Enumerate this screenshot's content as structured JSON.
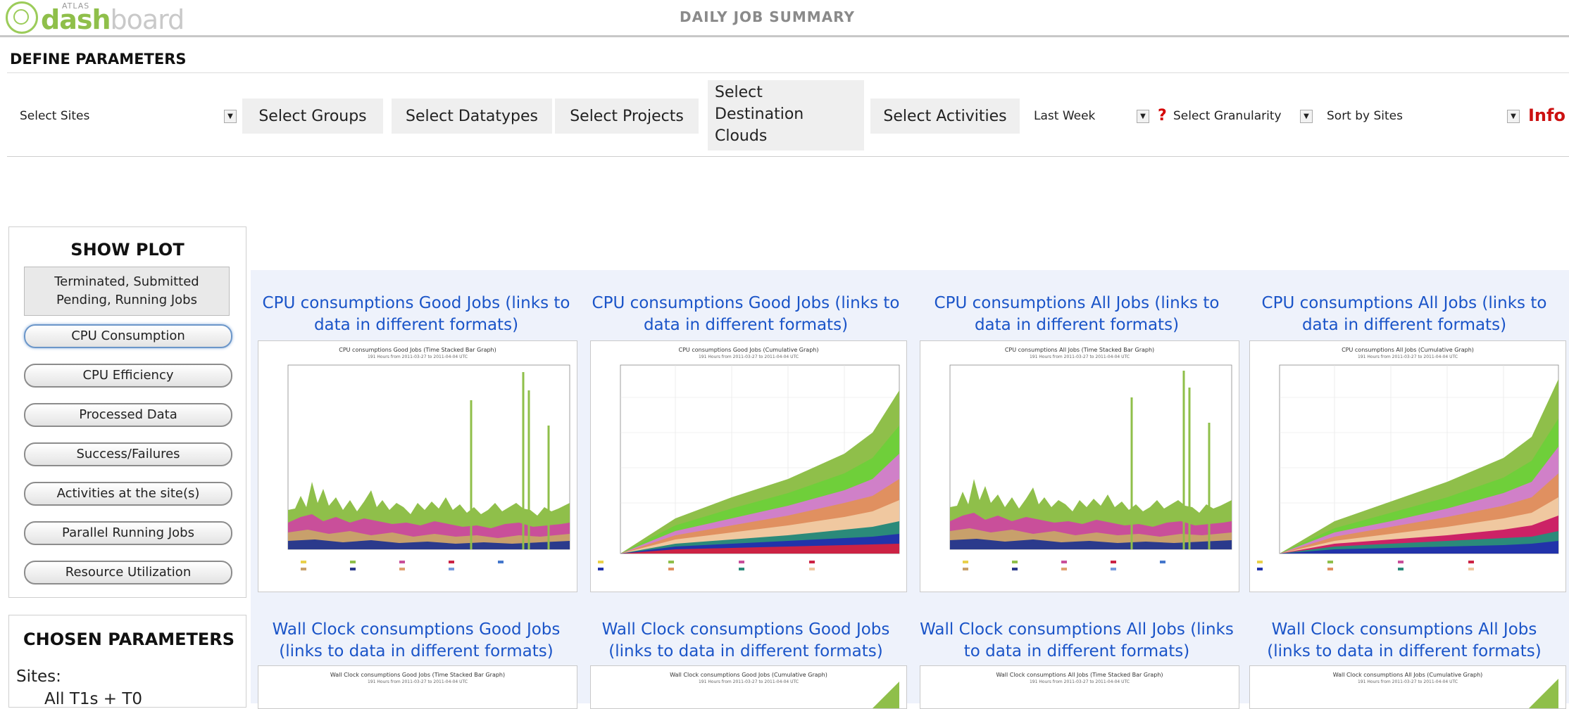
{
  "header": {
    "logo_atlas": "ATLAS",
    "logo_text_a": "dash",
    "logo_text_b": "board",
    "page_title": "DAILY JOB SUMMARY"
  },
  "define": {
    "title": "DEFINE PARAMETERS"
  },
  "params": {
    "sites": "Select Sites",
    "groups": "Select Groups",
    "datatypes": "Select Datatypes",
    "projects": "Select Projects",
    "destination": [
      "Select",
      "Destination",
      "Clouds"
    ],
    "activities": "Select Activities",
    "period": "Last Week",
    "help": "?",
    "granularity": "Select Granularity",
    "sort": "Sort by Sites",
    "info": "Info"
  },
  "show_plot": {
    "title": "SHOW PLOT",
    "summary_lines": [
      "Terminated, Submitted",
      "Pending, Running Jobs"
    ],
    "buttons": [
      "CPU Consumption",
      "CPU Efficiency",
      "Processed Data",
      "Success/Failures",
      "Activities at the site(s)",
      "Parallel Running Jobs",
      "Resource Utilization"
    ]
  },
  "chosen": {
    "title": "CHOSEN PARAMETERS",
    "sites_label": "Sites:",
    "sites_value": "All T1s + T0"
  },
  "plots_row1": [
    {
      "caption": [
        "CPU consumptions Good Jobs (links to",
        "data in different formats)"
      ],
      "title": "CPU consumptions Good Jobs (Time Stacked Bar Graph)",
      "subtitle": "191 Hours from 2011-03-27 to 2011-04-04 UTC",
      "kind": "bar"
    },
    {
      "caption": [
        "CPU consumptions Good Jobs (links to",
        "data in different formats)"
      ],
      "title": "CPU consumptions Good Jobs (Cumulative Graph)",
      "subtitle": "191 Hours from 2011-03-27 to 2011-04-04 UTC",
      "kind": "cumulative"
    },
    {
      "caption": [
        "CPU consumptions All Jobs (links to",
        "data in different formats)"
      ],
      "title": "CPU consumptions All Jobs (Time Stacked Bar Graph)",
      "subtitle": "191 Hours from 2011-03-27 to 2011-04-04 UTC",
      "kind": "bar"
    },
    {
      "caption": [
        "CPU consumptions All Jobs (links to",
        "data in different formats)"
      ],
      "title": "CPU consumptions All Jobs (Cumulative Graph)",
      "subtitle": "191 Hours from 2011-03-27 to 2011-04-04 UTC",
      "kind": "cumulative"
    }
  ],
  "plots_row2": [
    {
      "caption": [
        "Wall Clock consumptions Good Jobs",
        "(links to data in different formats)"
      ],
      "title": "Wall Clock consumptions Good Jobs (Time Stacked Bar Graph)",
      "subtitle": "191 Hours from 2011-03-27 to 2011-04-04 UTC"
    },
    {
      "caption": [
        "Wall Clock consumptions Good Jobs",
        "(links to data in different formats)"
      ],
      "title": "Wall Clock consumptions Good Jobs (Cumulative Graph)",
      "subtitle": "191 Hours from 2011-03-27 to 2011-04-04 UTC"
    },
    {
      "caption": [
        "Wall Clock consumptions All Jobs (links",
        "to data in different formats)"
      ],
      "title": "Wall Clock consumptions All Jobs (Time Stacked Bar Graph)",
      "subtitle": "191 Hours from 2011-03-27 to 2011-04-04 UTC"
    },
    {
      "caption": [
        "Wall Clock consumptions All Jobs",
        "(links to data in different formats)"
      ],
      "title": "Wall Clock consumptions All Jobs (Cumulative Graph)",
      "subtitle": "191 Hours from 2011-03-27 to 2011-04-04 UTC"
    }
  ],
  "colors": {
    "link": "#1a54c8",
    "info": "#cc1111",
    "logo_green": "#8fbf4a",
    "plot_bg": "#eef2fb"
  },
  "icons": {
    "dropdown": "chevron-down-icon",
    "help": "question-icon",
    "logo": "atlas-logo-icon"
  }
}
